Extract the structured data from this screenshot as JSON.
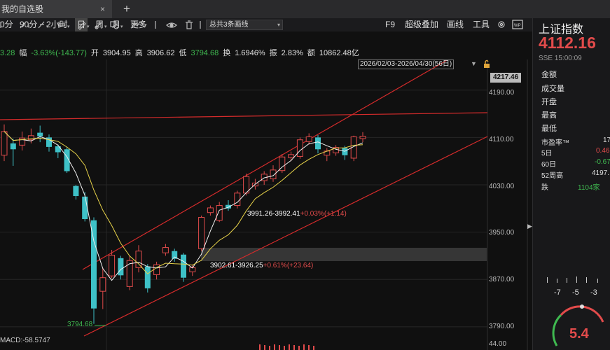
{
  "tabs": {
    "active": "我的自选股",
    "add": "+",
    "close": "×"
  },
  "toolbar": {
    "items_left": [
      {
        "name": "period-min",
        "label": "0分"
      },
      {
        "name": "period-90",
        "label": "90分"
      },
      {
        "name": "period-2h",
        "label": "2小时"
      },
      {
        "name": "period-day",
        "label": "日",
        "selected": true
      },
      {
        "name": "period-week",
        "label": "周"
      },
      {
        "name": "period-month",
        "label": "月"
      },
      {
        "name": "period-more",
        "label": "更多"
      }
    ],
    "right": [
      {
        "name": "f9",
        "label": "F9"
      },
      {
        "name": "overlay",
        "label": "超级叠加"
      },
      {
        "name": "draw-line",
        "label": "画线"
      },
      {
        "name": "tools",
        "label": "工具"
      }
    ],
    "drawing_dropdown": "总共3条画线"
  },
  "quote": {
    "partial": "3.28",
    "change_label": "幅",
    "change": "-3.63%(-143.77)",
    "open_label": "开",
    "open": "3904.95",
    "high_label": "高",
    "high": "3906.62",
    "low_label": "低",
    "low": "3794.68",
    "turnover_label": "换",
    "turnover": "1.6946%",
    "amp_label": "振",
    "amp": "2.83%",
    "amount_label": "额",
    "amount": "10862.48亿"
  },
  "range": "2026/02/03-2026/04/30(56日)",
  "y_ticks": [
    "4190.00",
    "4110.00",
    "4030.00",
    "3950.00",
    "3870.00",
    "3790.00"
  ],
  "max_label": "4217.46",
  "annotations": {
    "a1_range": "3991.26-3992.41",
    "a1_pct": "+0.03%(+1.14)",
    "a2_range": "3902.61-3926.25",
    "a2_pct": "+0.61%(+23.64)",
    "low": "3794.68"
  },
  "macd": "MACD:-58.5747",
  "vol_axis": "44.00",
  "right_panel": {
    "name": "上证指数",
    "price": "4112.16",
    "time": "SSE 15:00:09",
    "rows": [
      "金额",
      "成交量",
      "开盘",
      "最高",
      "最低"
    ],
    "pe_label": "市盈率™",
    "pe_val": "17",
    "d5_label": "5日",
    "d5_val": "0.46",
    "d60_label": "60日",
    "d60_val": "-0.67",
    "w52_label": "52周高",
    "w52_val": "4197.",
    "fall_label": "跌",
    "fall_val": "1104家",
    "bottom_nums": [
      "-7",
      "-5",
      "-3"
    ],
    "gauge": "5.4"
  },
  "chart_data": {
    "type": "candlestick",
    "ylim": [
      3778,
      4224
    ],
    "candles": [
      {
        "o": 4080,
        "c": 4120,
        "h": 4132,
        "l": 4070
      },
      {
        "o": 4100,
        "c": 4090,
        "h": 4108,
        "l": 4062
      },
      {
        "o": 4097,
        "c": 4109,
        "h": 4120,
        "l": 4088
      },
      {
        "o": 4106,
        "c": 4113,
        "h": 4125,
        "l": 4100
      },
      {
        "o": 4118,
        "c": 4112,
        "h": 4130,
        "l": 4102
      },
      {
        "o": 4110,
        "c": 4094,
        "h": 4115,
        "l": 4086
      },
      {
        "o": 4095,
        "c": 4085,
        "h": 4098,
        "l": 4075
      },
      {
        "o": 4090,
        "c": 4053,
        "h": 4094,
        "l": 4050
      },
      {
        "o": 4028,
        "c": 4011,
        "h": 4030,
        "l": 4005
      },
      {
        "o": 4010,
        "c": 3972,
        "h": 4018,
        "l": 3968
      },
      {
        "o": 3970,
        "c": 3821,
        "h": 3975,
        "l": 3795
      },
      {
        "o": 3850,
        "c": 3873,
        "h": 3890,
        "l": 3820
      },
      {
        "o": 3876,
        "c": 3911,
        "h": 3920,
        "l": 3872
      },
      {
        "o": 3906,
        "c": 3877,
        "h": 3910,
        "l": 3870
      },
      {
        "o": 3858,
        "c": 3902,
        "h": 3910,
        "l": 3852
      },
      {
        "o": 3890,
        "c": 3918,
        "h": 3928,
        "l": 3882
      },
      {
        "o": 3892,
        "c": 3855,
        "h": 3896,
        "l": 3848
      },
      {
        "o": 3878,
        "c": 3895,
        "h": 3900,
        "l": 3870
      },
      {
        "o": 3915,
        "c": 3924,
        "h": 3930,
        "l": 3910
      },
      {
        "o": 3918,
        "c": 3905,
        "h": 3922,
        "l": 3900
      },
      {
        "o": 3912,
        "c": 3873,
        "h": 3915,
        "l": 3866
      },
      {
        "o": 3883,
        "c": 3890,
        "h": 3895,
        "l": 3876
      },
      {
        "o": 3922,
        "c": 3975,
        "h": 3978,
        "l": 3918
      },
      {
        "o": 3983,
        "c": 3991,
        "h": 3995,
        "l": 3978
      },
      {
        "o": 3970,
        "c": 3995,
        "h": 4001,
        "l": 3967
      },
      {
        "o": 3996,
        "c": 3990,
        "h": 4004,
        "l": 3986
      },
      {
        "o": 3995,
        "c": 4016,
        "h": 4020,
        "l": 3990
      },
      {
        "o": 4016,
        "c": 4044,
        "h": 4049,
        "l": 4012
      },
      {
        "o": 4028,
        "c": 4033,
        "h": 4040,
        "l": 4022
      },
      {
        "o": 4037,
        "c": 4048,
        "h": 4053,
        "l": 4030
      },
      {
        "o": 4040,
        "c": 4055,
        "h": 4063,
        "l": 4035
      },
      {
        "o": 4054,
        "c": 4077,
        "h": 4082,
        "l": 4050
      },
      {
        "o": 4076,
        "c": 4081,
        "h": 4086,
        "l": 4070
      },
      {
        "o": 4078,
        "c": 4106,
        "h": 4110,
        "l": 4074
      },
      {
        "o": 4103,
        "c": 4111,
        "h": 4117,
        "l": 4098
      },
      {
        "o": 4110,
        "c": 4090,
        "h": 4114,
        "l": 4083
      },
      {
        "o": 4080,
        "c": 4087,
        "h": 4092,
        "l": 4070
      },
      {
        "o": 4084,
        "c": 4093,
        "h": 4097,
        "l": 4079
      },
      {
        "o": 4092,
        "c": 4080,
        "h": 4096,
        "l": 4072
      },
      {
        "o": 4075,
        "c": 4111,
        "h": 4113,
        "l": 4070
      },
      {
        "o": 4108,
        "c": 4112,
        "h": 4119,
        "l": 4102
      }
    ]
  }
}
